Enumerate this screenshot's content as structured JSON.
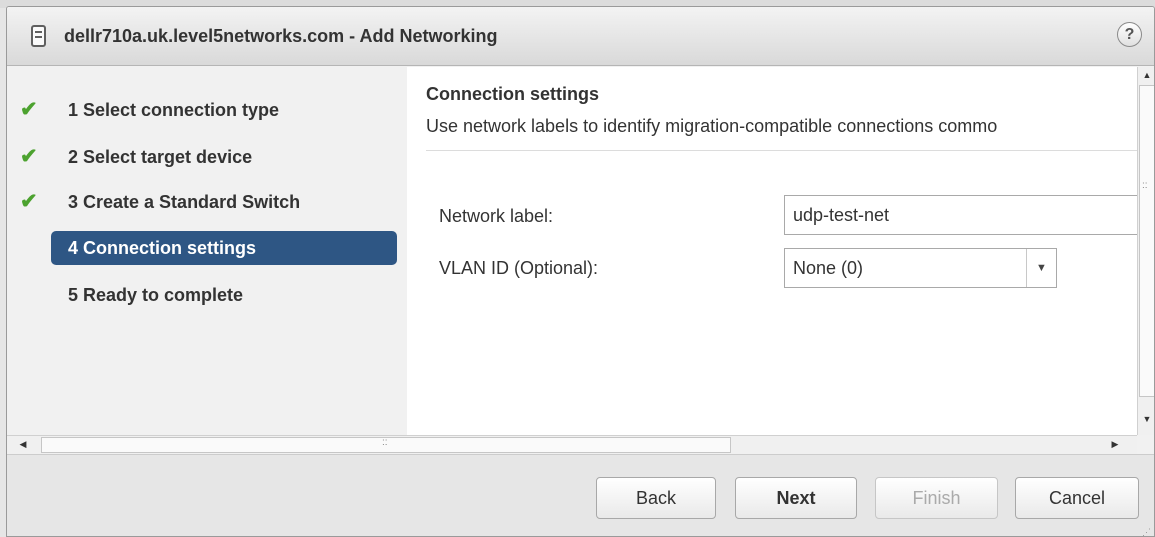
{
  "dialog": {
    "title": "dellr710a.uk.level5networks.com - Add Networking",
    "host_icon": "server-icon",
    "help_label": "?"
  },
  "steps": [
    {
      "label": "1  Select connection type",
      "done": true
    },
    {
      "label": "2  Select target device",
      "done": true
    },
    {
      "label": "3  Create a Standard Switch",
      "done": true
    },
    {
      "label": "4  Connection settings",
      "done": false,
      "active": true
    },
    {
      "label": "5  Ready to complete",
      "done": false
    }
  ],
  "check_glyph": "✔",
  "content": {
    "title": "Connection settings",
    "description": "Use network labels to identify migration-compatible connections commo",
    "network_label": {
      "label": "Network label:",
      "value": "udp-test-net"
    },
    "vlan": {
      "label": "VLAN ID (Optional):",
      "value": "None (0)",
      "arrow": "▼"
    }
  },
  "scrollbars": {
    "up": "▲",
    "down": "▼",
    "left": "◀",
    "right": "▶",
    "grip_v": "::",
    "grip_h": "::"
  },
  "footer": {
    "back": "Back",
    "next": "Next",
    "finish": "Finish",
    "cancel": "Cancel",
    "resize": "⋰"
  },
  "colors": {
    "active_step": "#2e5684",
    "check": "#4ca22f"
  }
}
